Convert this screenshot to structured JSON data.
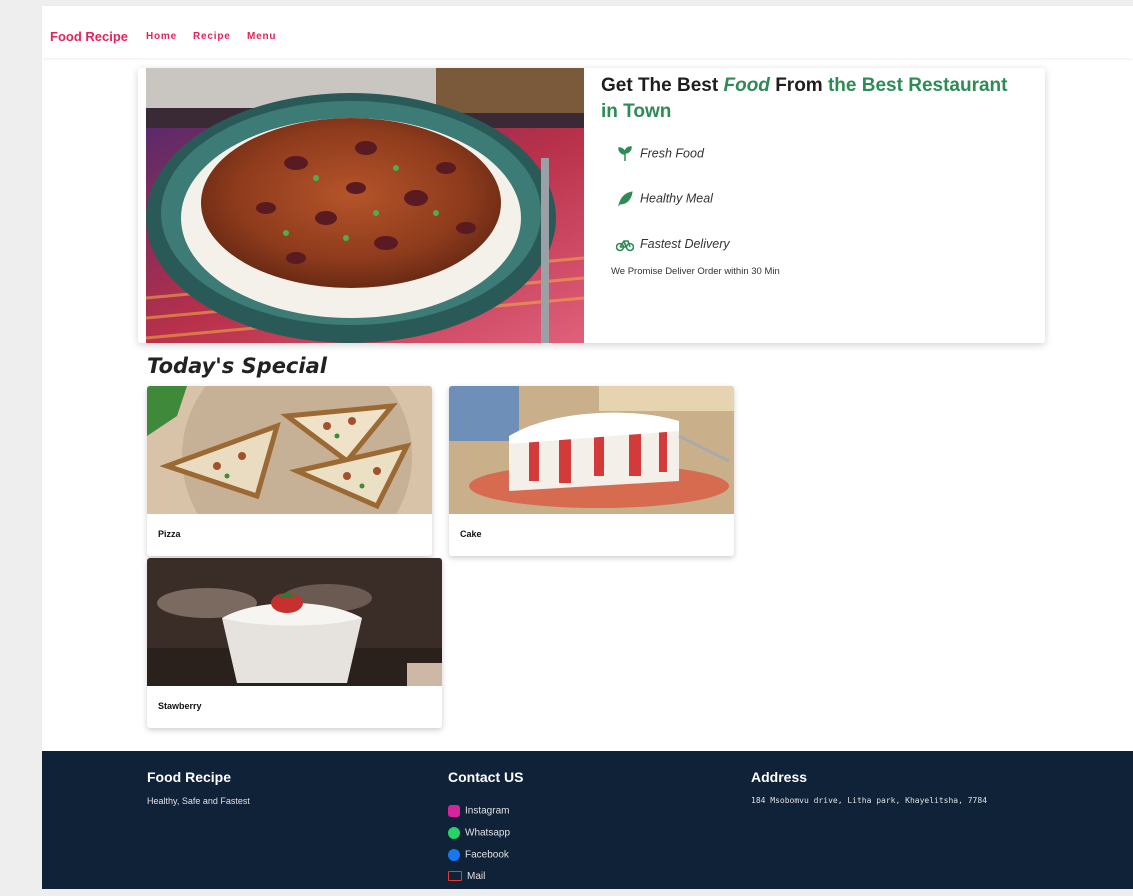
{
  "nav": {
    "brand": "Food Recipe",
    "links": [
      "Home",
      "Recipe",
      "Menu"
    ]
  },
  "hero": {
    "title_part1": "Get The Best ",
    "title_food": "Food",
    "title_part2": " From ",
    "title_green": "the Best Restaurant in Town",
    "features": [
      {
        "label": "Fresh Food",
        "icon": "seedling-icon"
      },
      {
        "label": "Healthy Meal",
        "icon": "leaf-icon"
      },
      {
        "label": "Fastest Delivery",
        "icon": "bicycle-icon"
      }
    ],
    "promise": "We Promise Deliver Order within 30 Min"
  },
  "special": {
    "heading": "Today's Special",
    "items": [
      {
        "label": "Pizza"
      },
      {
        "label": "Cake"
      },
      {
        "label": "Stawberry"
      }
    ]
  },
  "footer": {
    "col1_title": "Food Recipe",
    "col1_text": "Healthy, Safe and Fastest",
    "col2_title": "Contact US",
    "contacts": [
      {
        "label": "Instagram",
        "icon": "instagram-icon",
        "color": "#d6249f"
      },
      {
        "label": "Whatsapp",
        "icon": "whatsapp-icon",
        "color": "#25d366"
      },
      {
        "label": "Facebook",
        "icon": "facebook-icon",
        "color": "#1877f2"
      },
      {
        "label": "Mail",
        "icon": "mail-icon",
        "color": "#e53935"
      }
    ],
    "col3_title": "Address",
    "address": "184 Msobomvu drive, Litha park, Khayelitsha, 7784"
  },
  "colors": {
    "brand": "#e2245a",
    "accent_green": "#2e8b57",
    "footer_bg": "#0f2238"
  }
}
